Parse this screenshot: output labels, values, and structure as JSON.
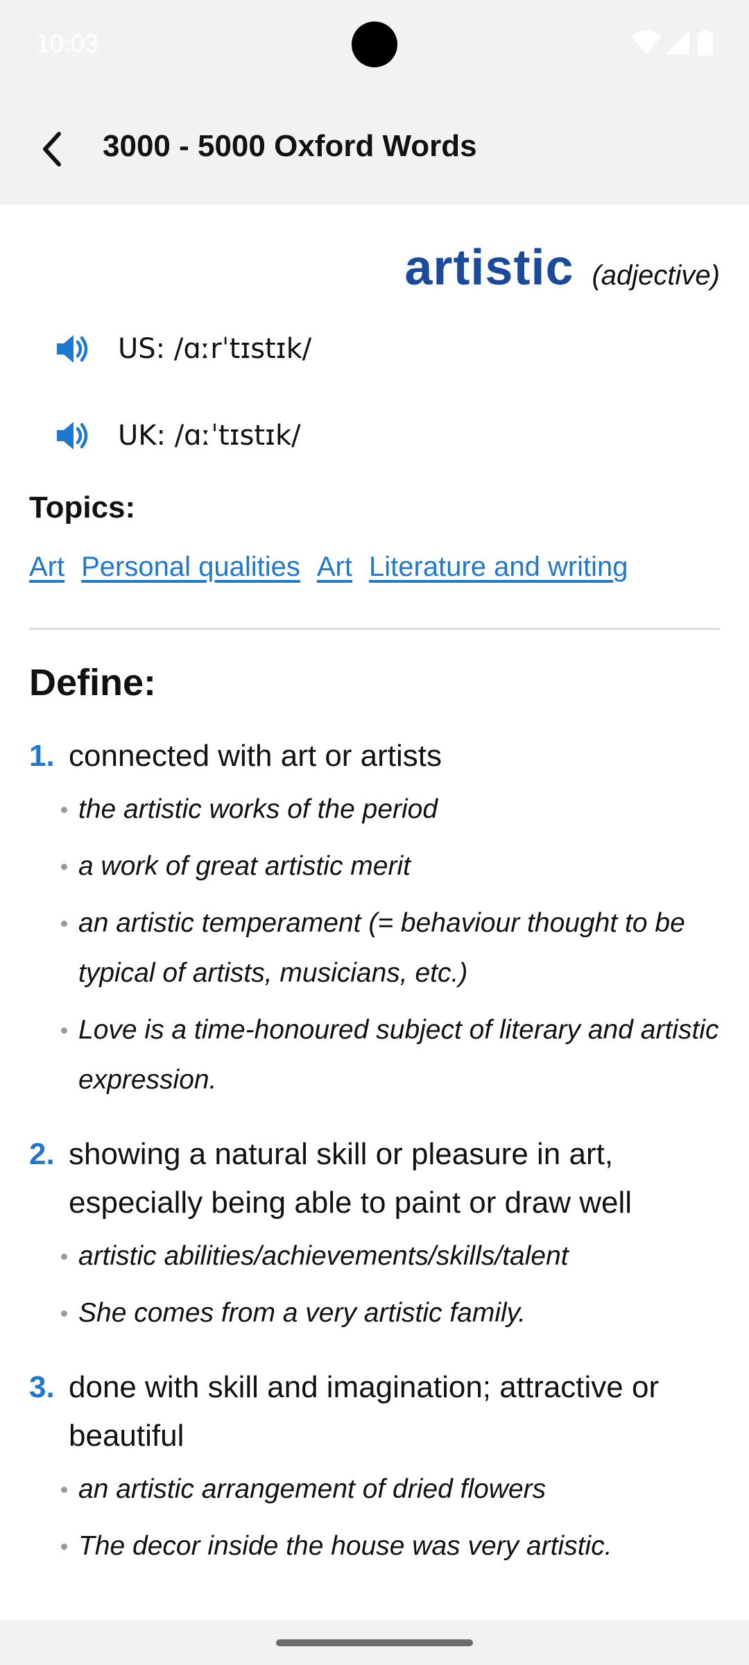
{
  "status_bar": {
    "time": "10:03",
    "icons": [
      "wifi-icon",
      "signal-icon",
      "battery-icon"
    ]
  },
  "app_bar": {
    "back_icon": "back-arrow-icon",
    "title": "3000 - 5000 Oxford Words"
  },
  "entry": {
    "headword": "artistic",
    "part_of_speech": "(adjective)",
    "pronunciations": [
      {
        "icon": "speaker-icon",
        "text": "US: /ɑːrˈtɪstɪk/"
      },
      {
        "icon": "speaker-icon",
        "text": "UK: /ɑːˈtɪstɪk/"
      }
    ],
    "topics_label": "Topics:",
    "topics": [
      "Art",
      "Personal qualities",
      "Art",
      "Literature and writing"
    ],
    "define_label": "Define:",
    "senses": [
      {
        "number": "1.",
        "definition": "connected with art or artists",
        "examples": [
          "the artistic works of the period",
          "a work of great artistic merit",
          "an artistic temperament (= behaviour thought to be typical of artists, musicians, etc.)",
          "Love is a time-honoured subject of literary and artistic expression."
        ]
      },
      {
        "number": "2.",
        "definition": "showing a natural skill or pleasure in art, especially being able to paint or draw well",
        "examples": [
          "artistic abilities/achievements/skills/talent",
          "She comes from a very artistic family."
        ]
      },
      {
        "number": "3.",
        "definition": "done with skill and imagination; attractive or beautiful",
        "examples": [
          "an artistic arrangement of dried flowers",
          "The decor inside the house was very artistic."
        ]
      }
    ]
  },
  "colors": {
    "headword": "#1a4a9c",
    "link": "#1e78d0",
    "app_bar_bg": "#f2f2f2"
  }
}
